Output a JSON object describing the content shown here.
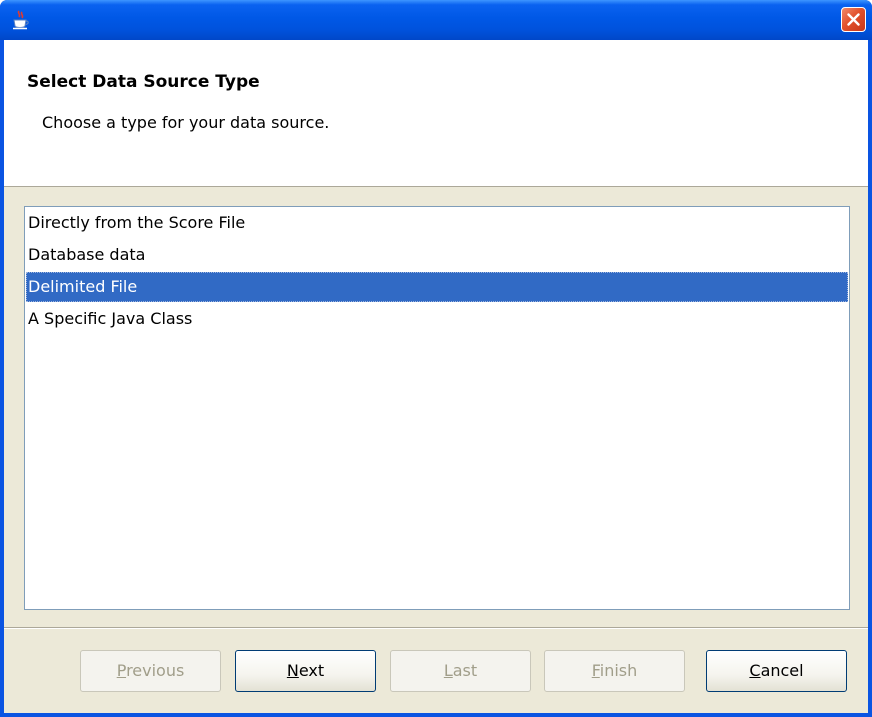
{
  "header": {
    "title": "Select Data Source Type",
    "subtitle": "Choose a type for your data source."
  },
  "list": {
    "items": [
      {
        "label": "Directly from the Score File",
        "selected": false
      },
      {
        "label": "Database data",
        "selected": false
      },
      {
        "label": "Delimited File",
        "selected": true
      },
      {
        "label": "A Specific Java Class",
        "selected": false
      }
    ]
  },
  "buttons": {
    "previous": {
      "mnemonic": "P",
      "rest": "revious",
      "enabled": false
    },
    "next": {
      "mnemonic": "N",
      "rest": "ext",
      "enabled": true
    },
    "last": {
      "mnemonic": "L",
      "rest": "ast",
      "enabled": false
    },
    "finish": {
      "mnemonic": "F",
      "rest": "inish",
      "enabled": false
    },
    "cancel": {
      "mnemonic": "C",
      "rest": "ancel",
      "enabled": true
    }
  },
  "icons": {
    "title_icon": "java-cup-icon",
    "close": "close-icon"
  },
  "colors": {
    "title_bar": "#0058e6",
    "selection": "#316ac5",
    "close_button": "#e2512c",
    "dialog_background": "#ece9d8"
  }
}
